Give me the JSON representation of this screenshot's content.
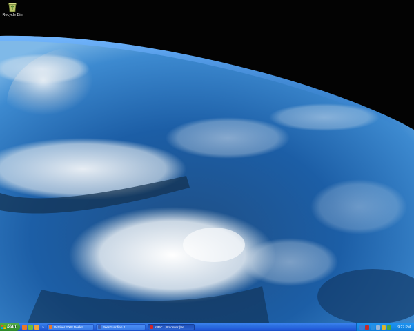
{
  "desktop": {
    "icons": [
      {
        "label": "Recycle Bin",
        "icon": "recycle-bin-icon"
      }
    ]
  },
  "taskbar": {
    "start_label": "Start",
    "quick_launch": [
      {
        "icon": "firefox-icon",
        "color": "#e8782a"
      },
      {
        "icon": "messenger-icon",
        "color": "#6fbf3a"
      },
      {
        "icon": "media-player-icon",
        "color": "#f2a43a"
      }
    ],
    "quick_launch_more": "»",
    "tasks": [
      {
        "label": "October 2008 Deskto...",
        "icon": "firefox-icon",
        "color": "#e8782a",
        "active": false
      },
      {
        "label": "PeerGuardian 2",
        "icon": "peerguardian-icon",
        "color": "#3c5fb0",
        "active": false
      },
      {
        "label": "mIRC - [#mosver (Ire...",
        "icon": "mirc-icon",
        "color": "#d0262a",
        "active": true
      }
    ],
    "tray_icons": [
      {
        "icon": "network-icon",
        "color": "#3d7ad6"
      },
      {
        "icon": "antivirus-icon",
        "color": "#c62a2a"
      },
      {
        "icon": "messenger-tray-icon",
        "color": "#2b8fe0"
      },
      {
        "icon": "volume-icon",
        "color": "#9ab6d8"
      },
      {
        "icon": "shield-icon",
        "color": "#d8b530"
      },
      {
        "icon": "update-icon",
        "color": "#46a640"
      }
    ],
    "clock": "9:27 PM"
  }
}
